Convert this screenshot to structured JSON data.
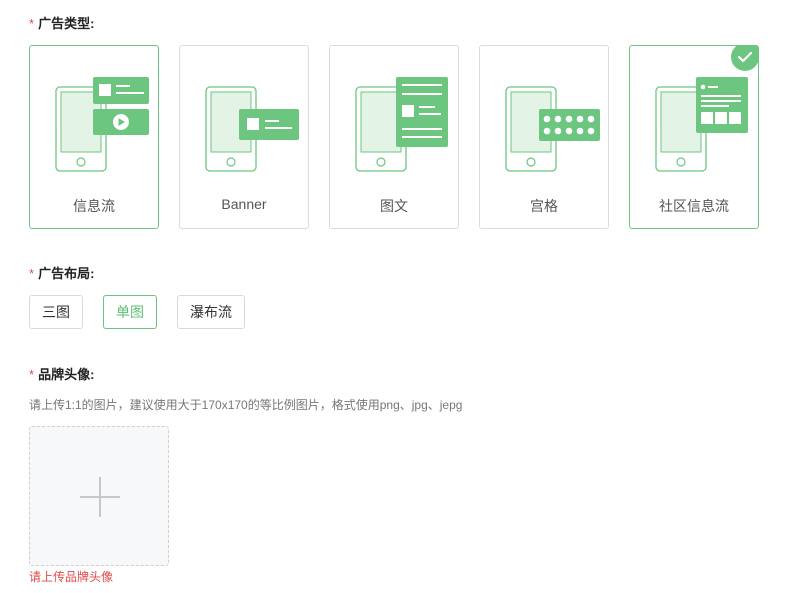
{
  "ad_type": {
    "label": "广告类型:",
    "required_mark": "*",
    "options": [
      {
        "label": "信息流",
        "selected": false
      },
      {
        "label": "Banner",
        "selected": false
      },
      {
        "label": "图文",
        "selected": false
      },
      {
        "label": "宫格",
        "selected": false
      },
      {
        "label": "社区信息流",
        "selected": true
      }
    ]
  },
  "ad_layout": {
    "label": "广告布局:",
    "required_mark": "*",
    "options": [
      {
        "label": "三图",
        "selected": false
      },
      {
        "label": "单图",
        "selected": true
      },
      {
        "label": "瀑布流",
        "selected": false
      }
    ]
  },
  "brand_avatar": {
    "label": "品牌头像:",
    "required_mark": "*",
    "hint": "请上传1:1的图片，建议使用大于170x170的等比例图片，格式使用png、jpg、jepg",
    "upload_icon": "plus-icon",
    "error": "请上传品牌头像"
  },
  "colors": {
    "accent": "#6cc680",
    "error": "#e24a4a",
    "phone_fill": "#e3f4e6"
  }
}
